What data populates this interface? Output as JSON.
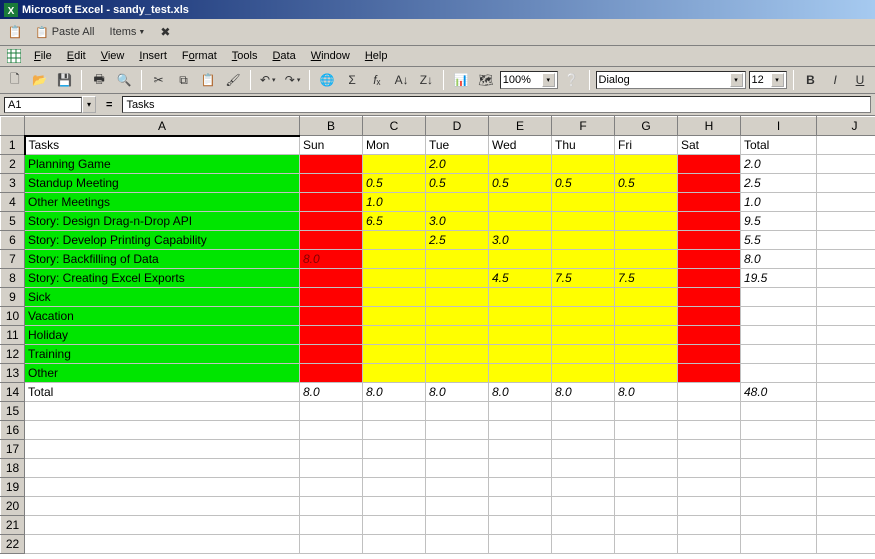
{
  "titlebar": {
    "text": "Microsoft Excel - sandy_test.xls"
  },
  "toolbar1": {
    "paste_all": "Paste All",
    "items": "Items"
  },
  "menu": {
    "file": "File",
    "edit": "Edit",
    "view": "View",
    "insert": "Insert",
    "format": "Format",
    "tools": "Tools",
    "data": "Data",
    "window": "Window",
    "help": "Help"
  },
  "toolbar_main": {
    "zoom": "100%",
    "font_name": "Dialog",
    "font_size": "12"
  },
  "formula": {
    "name_box": "A1",
    "value": "Tasks"
  },
  "columns": [
    "A",
    "B",
    "C",
    "D",
    "E",
    "F",
    "G",
    "H",
    "I",
    "J"
  ],
  "headers": {
    "A": "Tasks",
    "B": "Sun",
    "C": "Mon",
    "D": "Tue",
    "E": "Wed",
    "F": "Thu",
    "G": "Fri",
    "H": "Sat",
    "I": "Total",
    "J": ""
  },
  "rows": [
    {
      "n": 2,
      "A": {
        "v": "Planning Game",
        "c": "green"
      },
      "B": {
        "v": "",
        "c": "red"
      },
      "C": {
        "v": "",
        "c": "yellow",
        "i": true
      },
      "D": {
        "v": "2.0",
        "c": "yellow",
        "i": true
      },
      "E": {
        "v": "",
        "c": "yellow",
        "i": true
      },
      "F": {
        "v": "",
        "c": "yellow",
        "i": true
      },
      "G": {
        "v": "",
        "c": "yellow",
        "i": true
      },
      "H": {
        "v": "",
        "c": "red"
      },
      "I": {
        "v": "2.0",
        "i": true
      }
    },
    {
      "n": 3,
      "A": {
        "v": "Standup Meeting",
        "c": "green"
      },
      "B": {
        "v": "",
        "c": "red"
      },
      "C": {
        "v": "0.5",
        "c": "yellow",
        "i": true
      },
      "D": {
        "v": "0.5",
        "c": "yellow",
        "i": true
      },
      "E": {
        "v": "0.5",
        "c": "yellow",
        "i": true
      },
      "F": {
        "v": "0.5",
        "c": "yellow",
        "i": true
      },
      "G": {
        "v": "0.5",
        "c": "yellow",
        "i": true
      },
      "H": {
        "v": "",
        "c": "red"
      },
      "I": {
        "v": "2.5",
        "i": true
      }
    },
    {
      "n": 4,
      "A": {
        "v": "Other Meetings",
        "c": "green"
      },
      "B": {
        "v": "",
        "c": "red"
      },
      "C": {
        "v": "1.0",
        "c": "yellow",
        "i": true
      },
      "D": {
        "v": "",
        "c": "yellow",
        "i": true
      },
      "E": {
        "v": "",
        "c": "yellow",
        "i": true
      },
      "F": {
        "v": "",
        "c": "yellow",
        "i": true
      },
      "G": {
        "v": "",
        "c": "yellow",
        "i": true
      },
      "H": {
        "v": "",
        "c": "red"
      },
      "I": {
        "v": "1.0",
        "i": true
      }
    },
    {
      "n": 5,
      "A": {
        "v": "Story: Design Drag-n-Drop API",
        "c": "green"
      },
      "B": {
        "v": "",
        "c": "red"
      },
      "C": {
        "v": "6.5",
        "c": "yellow",
        "i": true
      },
      "D": {
        "v": "3.0",
        "c": "yellow",
        "i": true
      },
      "E": {
        "v": "",
        "c": "yellow",
        "i": true
      },
      "F": {
        "v": "",
        "c": "yellow",
        "i": true
      },
      "G": {
        "v": "",
        "c": "yellow",
        "i": true
      },
      "H": {
        "v": "",
        "c": "red"
      },
      "I": {
        "v": "9.5",
        "i": true
      }
    },
    {
      "n": 6,
      "A": {
        "v": "Story: Develop Printing Capability",
        "c": "green"
      },
      "B": {
        "v": "",
        "c": "red"
      },
      "C": {
        "v": "",
        "c": "yellow",
        "i": true
      },
      "D": {
        "v": "2.5",
        "c": "yellow",
        "i": true
      },
      "E": {
        "v": "3.0",
        "c": "yellow",
        "i": true
      },
      "F": {
        "v": "",
        "c": "yellow",
        "i": true
      },
      "G": {
        "v": "",
        "c": "yellow",
        "i": true
      },
      "H": {
        "v": "",
        "c": "red"
      },
      "I": {
        "v": "5.5",
        "i": true
      }
    },
    {
      "n": 7,
      "A": {
        "v": "Story: Backfilling of Data",
        "c": "green"
      },
      "B": {
        "v": "8.0",
        "c": "red",
        "i": true,
        "tc": "darkred-text"
      },
      "C": {
        "v": "",
        "c": "yellow",
        "i": true
      },
      "D": {
        "v": "",
        "c": "yellow",
        "i": true
      },
      "E": {
        "v": "",
        "c": "yellow",
        "i": true
      },
      "F": {
        "v": "",
        "c": "yellow",
        "i": true
      },
      "G": {
        "v": "",
        "c": "yellow",
        "i": true
      },
      "H": {
        "v": "",
        "c": "red"
      },
      "I": {
        "v": "8.0",
        "i": true
      }
    },
    {
      "n": 8,
      "A": {
        "v": "Story: Creating Excel Exports",
        "c": "green"
      },
      "B": {
        "v": "",
        "c": "red"
      },
      "C": {
        "v": "",
        "c": "yellow",
        "i": true
      },
      "D": {
        "v": "",
        "c": "yellow",
        "i": true
      },
      "E": {
        "v": "4.5",
        "c": "yellow",
        "i": true
      },
      "F": {
        "v": "7.5",
        "c": "yellow",
        "i": true
      },
      "G": {
        "v": "7.5",
        "c": "yellow",
        "i": true
      },
      "H": {
        "v": "",
        "c": "red"
      },
      "I": {
        "v": "19.5",
        "i": true
      }
    },
    {
      "n": 9,
      "A": {
        "v": "Sick",
        "c": "green"
      },
      "B": {
        "v": "",
        "c": "red"
      },
      "C": {
        "v": "",
        "c": "yellow"
      },
      "D": {
        "v": "",
        "c": "yellow"
      },
      "E": {
        "v": "",
        "c": "yellow"
      },
      "F": {
        "v": "",
        "c": "yellow"
      },
      "G": {
        "v": "",
        "c": "yellow"
      },
      "H": {
        "v": "",
        "c": "red"
      },
      "I": {
        "v": ""
      }
    },
    {
      "n": 10,
      "A": {
        "v": "Vacation",
        "c": "green"
      },
      "B": {
        "v": "",
        "c": "red"
      },
      "C": {
        "v": "",
        "c": "yellow"
      },
      "D": {
        "v": "",
        "c": "yellow"
      },
      "E": {
        "v": "",
        "c": "yellow"
      },
      "F": {
        "v": "",
        "c": "yellow"
      },
      "G": {
        "v": "",
        "c": "yellow"
      },
      "H": {
        "v": "",
        "c": "red"
      },
      "I": {
        "v": ""
      }
    },
    {
      "n": 11,
      "A": {
        "v": "Holiday",
        "c": "green"
      },
      "B": {
        "v": "",
        "c": "red"
      },
      "C": {
        "v": "",
        "c": "yellow"
      },
      "D": {
        "v": "",
        "c": "yellow"
      },
      "E": {
        "v": "",
        "c": "yellow"
      },
      "F": {
        "v": "",
        "c": "yellow"
      },
      "G": {
        "v": "",
        "c": "yellow"
      },
      "H": {
        "v": "",
        "c": "red"
      },
      "I": {
        "v": ""
      }
    },
    {
      "n": 12,
      "A": {
        "v": "Training",
        "c": "green"
      },
      "B": {
        "v": "",
        "c": "red"
      },
      "C": {
        "v": "",
        "c": "yellow"
      },
      "D": {
        "v": "",
        "c": "yellow"
      },
      "E": {
        "v": "",
        "c": "yellow"
      },
      "F": {
        "v": "",
        "c": "yellow"
      },
      "G": {
        "v": "",
        "c": "yellow"
      },
      "H": {
        "v": "",
        "c": "red"
      },
      "I": {
        "v": ""
      }
    },
    {
      "n": 13,
      "A": {
        "v": "Other",
        "c": "green"
      },
      "B": {
        "v": "",
        "c": "red"
      },
      "C": {
        "v": "",
        "c": "yellow"
      },
      "D": {
        "v": "",
        "c": "yellow"
      },
      "E": {
        "v": "",
        "c": "yellow"
      },
      "F": {
        "v": "",
        "c": "yellow"
      },
      "G": {
        "v": "",
        "c": "yellow"
      },
      "H": {
        "v": "",
        "c": "red"
      },
      "I": {
        "v": ""
      }
    },
    {
      "n": 14,
      "A": {
        "v": "Total"
      },
      "B": {
        "v": "8.0",
        "i": true
      },
      "C": {
        "v": "8.0",
        "i": true
      },
      "D": {
        "v": "8.0",
        "i": true
      },
      "E": {
        "v": "8.0",
        "i": true
      },
      "F": {
        "v": "8.0",
        "i": true
      },
      "G": {
        "v": "8.0",
        "i": true
      },
      "H": {
        "v": ""
      },
      "I": {
        "v": "48.0",
        "i": true
      }
    },
    {
      "n": 15
    },
    {
      "n": 16
    },
    {
      "n": 17
    },
    {
      "n": 18
    },
    {
      "n": 19
    },
    {
      "n": 20
    },
    {
      "n": 21
    },
    {
      "n": 22
    }
  ],
  "chart_data": {
    "type": "table",
    "title": "Weekly Task Hours",
    "columns": [
      "Tasks",
      "Sun",
      "Mon",
      "Tue",
      "Wed",
      "Thu",
      "Fri",
      "Sat",
      "Total"
    ],
    "rows": [
      [
        "Planning Game",
        null,
        null,
        2.0,
        null,
        null,
        null,
        null,
        2.0
      ],
      [
        "Standup Meeting",
        null,
        0.5,
        0.5,
        0.5,
        0.5,
        0.5,
        null,
        2.5
      ],
      [
        "Other Meetings",
        null,
        1.0,
        null,
        null,
        null,
        null,
        null,
        1.0
      ],
      [
        "Story: Design Drag-n-Drop API",
        null,
        6.5,
        3.0,
        null,
        null,
        null,
        null,
        9.5
      ],
      [
        "Story: Develop Printing Capability",
        null,
        null,
        2.5,
        3.0,
        null,
        null,
        null,
        5.5
      ],
      [
        "Story: Backfilling of Data",
        8.0,
        null,
        null,
        null,
        null,
        null,
        null,
        8.0
      ],
      [
        "Story: Creating Excel Exports",
        null,
        null,
        null,
        4.5,
        7.5,
        7.5,
        null,
        19.5
      ],
      [
        "Sick",
        null,
        null,
        null,
        null,
        null,
        null,
        null,
        null
      ],
      [
        "Vacation",
        null,
        null,
        null,
        null,
        null,
        null,
        null,
        null
      ],
      [
        "Holiday",
        null,
        null,
        null,
        null,
        null,
        null,
        null,
        null
      ],
      [
        "Training",
        null,
        null,
        null,
        null,
        null,
        null,
        null,
        null
      ],
      [
        "Other",
        null,
        null,
        null,
        null,
        null,
        null,
        null,
        null
      ],
      [
        "Total",
        8.0,
        8.0,
        8.0,
        8.0,
        8.0,
        8.0,
        null,
        48.0
      ]
    ]
  }
}
